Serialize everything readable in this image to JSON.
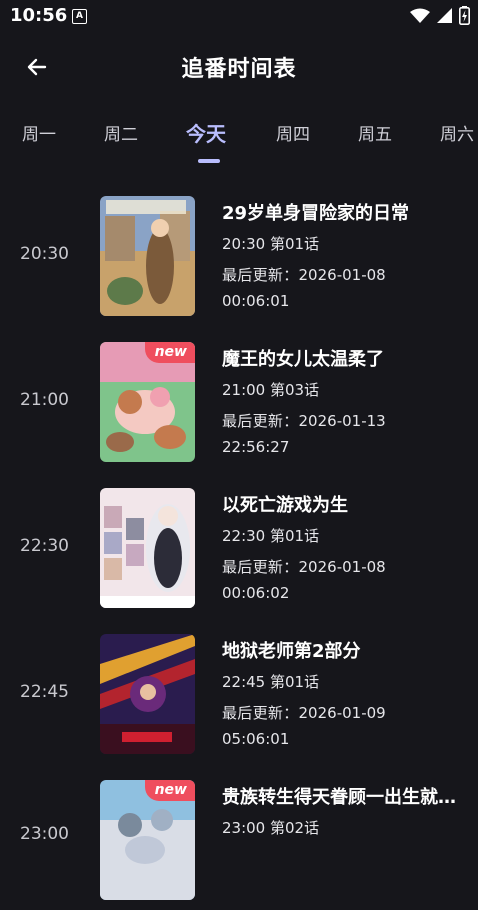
{
  "status_bar": {
    "time": "10:56",
    "notification_glyph": "A",
    "icons": [
      "wifi-icon",
      "signal-icon",
      "battery-icon"
    ]
  },
  "app_bar": {
    "back_icon": "arrow-left-icon",
    "title": "追番时间表"
  },
  "tabs": [
    {
      "label": "周一",
      "active": false
    },
    {
      "label": "周二",
      "active": false
    },
    {
      "label": "今天",
      "active": true
    },
    {
      "label": "周四",
      "active": false
    },
    {
      "label": "周五",
      "active": false
    },
    {
      "label": "周六",
      "active": false
    }
  ],
  "schedule": [
    {
      "time": "20:30",
      "title": "29岁单身冒险家的日常",
      "episode": "20:30 第01话",
      "updated_label": "最后更新：",
      "updated_date": "2026-01-08",
      "updated_time": "00:06:01",
      "is_new": false,
      "poster_colors": [
        "#8aa3c6",
        "#c8a26b",
        "#5d7a4a"
      ]
    },
    {
      "time": "21:00",
      "title": "魔王的女儿太温柔了",
      "episode": "21:00 第03话",
      "updated_label": "最后更新：",
      "updated_date": "2026-01-13",
      "updated_time": "22:56:27",
      "is_new": true,
      "badge": "new",
      "poster_colors": [
        "#7fc48b",
        "#e69bb5",
        "#c47a4e"
      ]
    },
    {
      "time": "22:30",
      "title": "以死亡游戏为生",
      "episode": "22:30 第01话",
      "updated_label": "最后更新：",
      "updated_date": "2026-01-08",
      "updated_time": "00:06:02",
      "is_new": false,
      "poster_colors": [
        "#f2e6ea",
        "#c9a9b7",
        "#8d8da0"
      ]
    },
    {
      "time": "22:45",
      "title": "地狱老师第2部分",
      "episode": "22:45 第01话",
      "updated_label": "最后更新：",
      "updated_date": "2026-01-09",
      "updated_time": "05:06:01",
      "is_new": false,
      "poster_colors": [
        "#2a1c4e",
        "#b3242e",
        "#e0a030"
      ]
    },
    {
      "time": "23:00",
      "title": "贵族转生得天眷顾一出生就获得最强力量",
      "episode": "23:00 第02话",
      "updated_label": "",
      "updated_date": "",
      "updated_time": "",
      "is_new": true,
      "badge": "new",
      "poster_colors": [
        "#8fc0e0",
        "#d9dde6",
        "#7a8a9c"
      ]
    }
  ]
}
